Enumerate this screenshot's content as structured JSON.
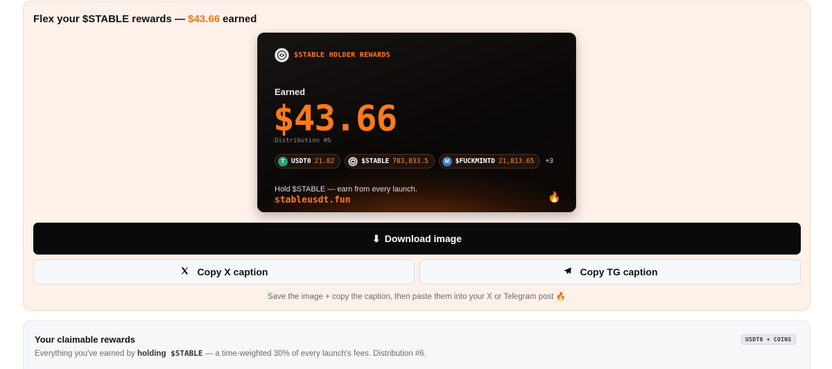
{
  "flex": {
    "title_prefix": "Flex your $STABLE rewards — ",
    "title_amount": "$43.66",
    "title_suffix": " earned"
  },
  "card": {
    "header": "$STABLE HOLDER REWARDS",
    "earned_label": "Earned",
    "amount": "$43.66",
    "distribution": "Distribution #6",
    "chips": [
      {
        "icon": "usdt-coin-icon",
        "letter": "T",
        "token": "USDT0",
        "value": "21.82"
      },
      {
        "icon": "stable-coin-icon",
        "letter": "",
        "token": "$STABLE",
        "value": "783,833.5"
      },
      {
        "icon": "fuckmintd-coin-icon",
        "letter": "M",
        "token": "$FUCKMINTD",
        "value": "21,813.65"
      }
    ],
    "more": "+3",
    "tagline": "Hold $STABLE — earn from every launch.",
    "url": "stableusdt.fun",
    "fire_icon": "🔥"
  },
  "actions": {
    "download_icon": "⬇",
    "download_label": "Download image",
    "copy_x_icon": "𝕏",
    "copy_x_label": "Copy X caption",
    "copy_tg_label": "Copy TG caption",
    "hint": "Save the image + copy the caption, then paste them into your X or Telegram post 🔥"
  },
  "rewards": {
    "title": "Your claimable rewards",
    "desc_prefix": "Everything you've earned by ",
    "desc_bold": "holding",
    "desc_mono": " $STABLE",
    "desc_suffix": " — a time-weighted 30% of every launch's fees. Distribution #6.",
    "badge": "USDT0 + COINS"
  },
  "colors": {
    "accent": "#ef7a1a",
    "panel_bg": "#fdf1ea",
    "card_bg": "#0a0807"
  }
}
